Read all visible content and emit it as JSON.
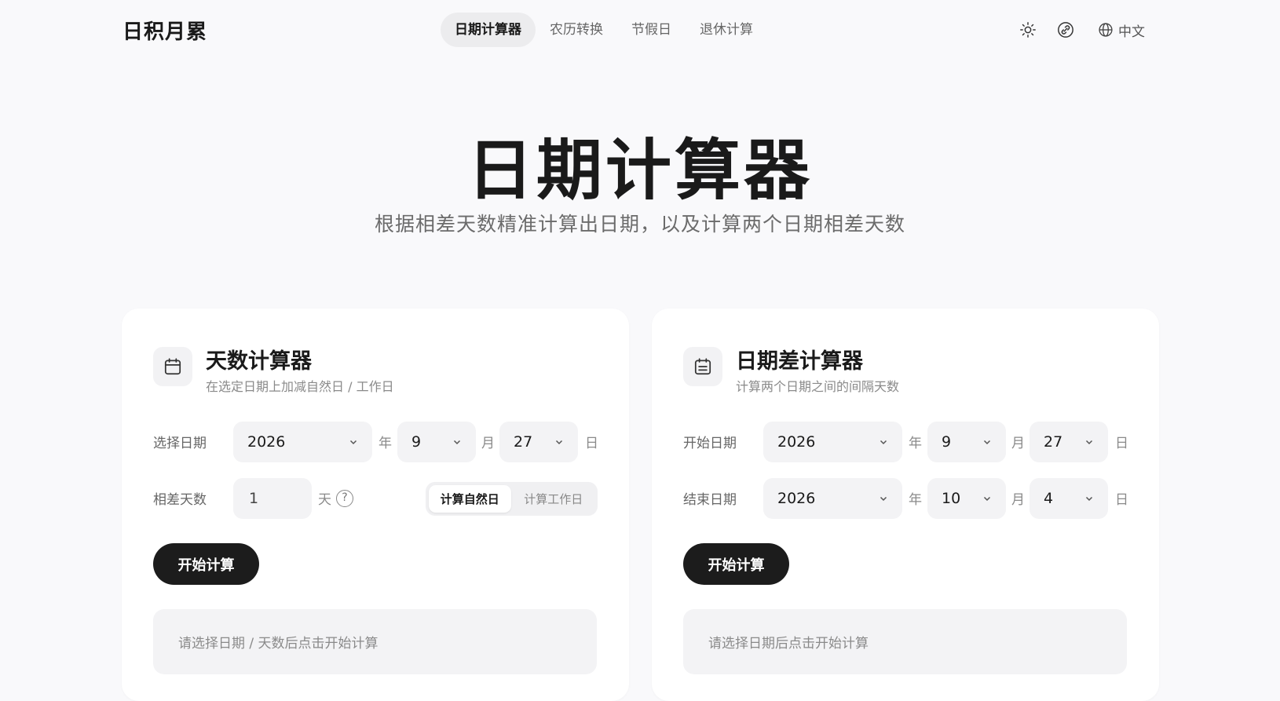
{
  "header": {
    "brand": "日积月累",
    "nav": [
      {
        "label": "日期计算器",
        "active": true
      },
      {
        "label": "农历转换",
        "active": false
      },
      {
        "label": "节假日",
        "active": false
      },
      {
        "label": "退休计算",
        "active": false
      }
    ],
    "theme_icon": "sun-icon",
    "link_icon": "link-icon",
    "language": {
      "icon": "globe-icon",
      "label": "中文"
    }
  },
  "hero": {
    "title": "日期计算器",
    "subtitle": "根据相差天数精准计算出日期，以及计算两个日期相差天数"
  },
  "days_calculator": {
    "icon": "calendar-icon",
    "title": "天数计算器",
    "subtitle": "在选定日期上加减自然日 / 工作日",
    "date_label": "选择日期",
    "year": "2026",
    "year_unit": "年",
    "month": "9",
    "month_unit": "月",
    "day": "27",
    "day_unit": "日",
    "diff_label": "相差天数",
    "diff_value": "1",
    "diff_unit": "天",
    "help": "?",
    "mode_options": [
      "计算自然日",
      "计算工作日"
    ],
    "selected_mode": "计算自然日",
    "button": "开始计算",
    "result_placeholder": "请选择日期 / 天数后点击开始计算"
  },
  "date_diff_calculator": {
    "icon": "calendar-range-icon",
    "title": "日期差计算器",
    "subtitle": "计算两个日期之间的间隔天数",
    "start_label": "开始日期",
    "start_year": "2026",
    "start_month": "9",
    "start_day": "27",
    "end_label": "结束日期",
    "end_year": "2026",
    "end_month": "10",
    "end_day": "4",
    "year_unit": "年",
    "month_unit": "月",
    "day_unit": "日",
    "button": "开始计算",
    "result_placeholder": "请选择日期后点击开始计算"
  },
  "colors": {
    "background": "#f9f9fb",
    "card": "#ffffff",
    "field": "#f3f3f5",
    "primary_button": "#1c1c1c"
  }
}
